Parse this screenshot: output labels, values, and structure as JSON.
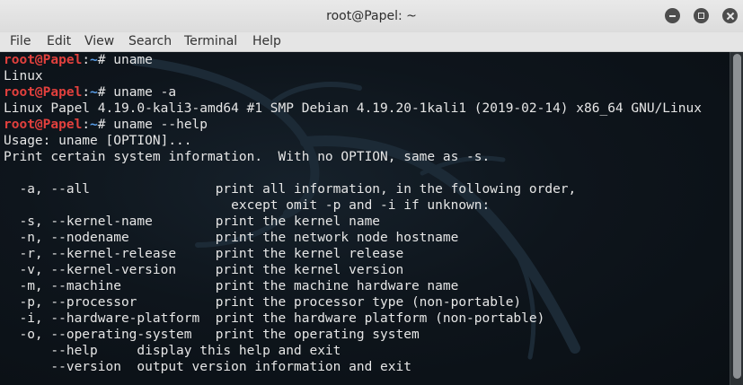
{
  "window": {
    "title": "root@Papel: ~"
  },
  "menu": {
    "items": [
      "File",
      "Edit",
      "View",
      "Search",
      "Terminal",
      "Help"
    ]
  },
  "icons": {
    "minimize": "minimize-icon",
    "maximize": "maximize-icon",
    "close": "close-icon",
    "watermark": "kali-dragon-logo"
  },
  "colors": {
    "prompt_user": "#e2403d",
    "prompt_path": "#5a9ee8",
    "terminal_text": "#e6e6e6",
    "terminal_bg": "#0e151c"
  },
  "prompt": {
    "user": "root@Papel",
    "sep": ":",
    "path": "~",
    "symbol": "# "
  },
  "terminal": {
    "lines": [
      {
        "type": "prompt",
        "cmd": "uname"
      },
      {
        "type": "out",
        "text": "Linux"
      },
      {
        "type": "prompt",
        "cmd": "uname -a"
      },
      {
        "type": "out",
        "text": "Linux Papel 4.19.0-kali3-amd64 #1 SMP Debian 4.19.20-1kali1 (2019-02-14) x86_64 GNU/Linux"
      },
      {
        "type": "prompt",
        "cmd": "uname --help"
      },
      {
        "type": "out",
        "text": "Usage: uname [OPTION]..."
      },
      {
        "type": "out",
        "text": "Print certain system information.  With no OPTION, same as -s."
      },
      {
        "type": "out",
        "text": ""
      },
      {
        "type": "out",
        "text": "  -a, --all                print all information, in the following order,"
      },
      {
        "type": "out",
        "text": "                             except omit -p and -i if unknown:"
      },
      {
        "type": "out",
        "text": "  -s, --kernel-name        print the kernel name"
      },
      {
        "type": "out",
        "text": "  -n, --nodename           print the network node hostname"
      },
      {
        "type": "out",
        "text": "  -r, --kernel-release     print the kernel release"
      },
      {
        "type": "out",
        "text": "  -v, --kernel-version     print the kernel version"
      },
      {
        "type": "out",
        "text": "  -m, --machine            print the machine hardware name"
      },
      {
        "type": "out",
        "text": "  -p, --processor          print the processor type (non-portable)"
      },
      {
        "type": "out",
        "text": "  -i, --hardware-platform  print the hardware platform (non-portable)"
      },
      {
        "type": "out",
        "text": "  -o, --operating-system   print the operating system"
      },
      {
        "type": "out",
        "text": "      --help     display this help and exit"
      },
      {
        "type": "out",
        "text": "      --version  output version information and exit"
      }
    ]
  }
}
